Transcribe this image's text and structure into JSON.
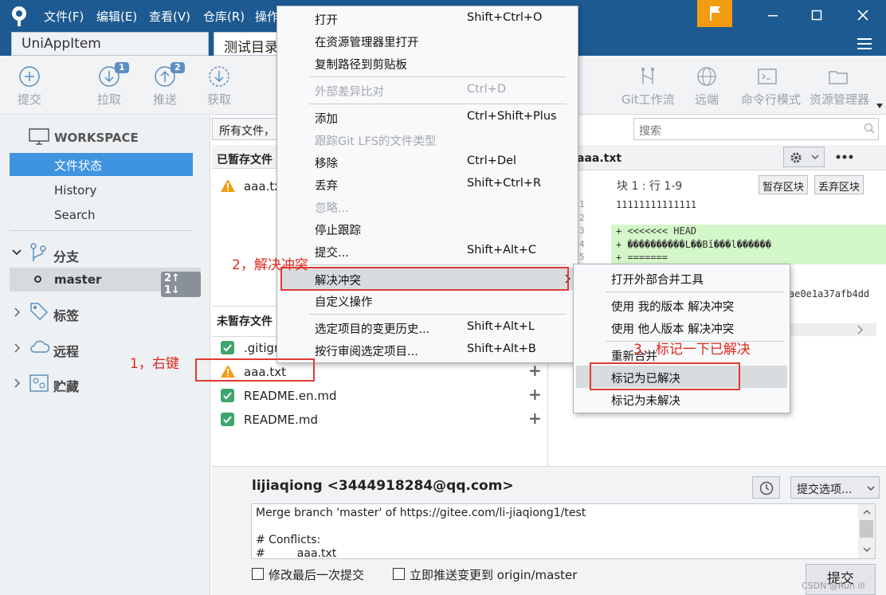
{
  "menubar": {
    "items": [
      "文件(F)",
      "编辑(E)",
      "查看(V)",
      "仓库(R)",
      "操作"
    ]
  },
  "tabs": [
    "UniAppItem",
    "测试目录"
  ],
  "toolbar": {
    "commit": "提交",
    "pull": "拉取",
    "push": "推送",
    "fetch": "获取",
    "pull_badge": "1",
    "push_badge": "2",
    "gitflow": "Git工作流",
    "remote": "远端",
    "terminal": "命令行模式",
    "explorer": "资源管理器"
  },
  "sidebar": {
    "workspace": "WORKSPACE",
    "file_status": "文件状态",
    "history": "History",
    "search": "Search",
    "branches": "分支",
    "master": "master",
    "master_badge": "2↑ 1↓",
    "tags": "标签",
    "remotes": "远程",
    "stashes": "贮藏"
  },
  "filter": {
    "label": "所有文件，",
    "search_placeholder": "搜索"
  },
  "staged": {
    "title": "已暂存文件",
    "files": [
      "aaa.txt"
    ]
  },
  "unstaged": {
    "title": "未暂存文件",
    "files": [
      ".gitignore",
      "aaa.txt",
      "README.en.md",
      "README.md"
    ]
  },
  "diff": {
    "filename": "aaa.txt",
    "hunk": "块 1 :  行 1-9",
    "stage_hunk": "暂存区块",
    "discard_hunk": "丢弃区块",
    "line_numbers": [
      "1",
      "2",
      "3",
      "4",
      "5"
    ],
    "lines": [
      "11111111111111",
      "",
      "+ <<<<<<< HEAD",
      "+ ����������L��Bǐ���l������",
      "+ ======="
    ],
    "hash_fragment": "ae0e1a37afb4dd"
  },
  "commit_area": {
    "author": "lijiaqiong <3444918284@qq.com>",
    "options": "提交选项...",
    "message_lines": [
      "Merge branch 'master' of https://gitee.com/li-jiaqiong1/test",
      "",
      "# Conflicts:",
      "#         aaa.txt"
    ],
    "amend": "修改最后一次提交",
    "push_now": "立即推送变更到 origin/master",
    "commit_button": "提交"
  },
  "context_menu": {
    "items": [
      {
        "label": "打开",
        "shortcut": "Shift+Ctrl+O",
        "enabled": true
      },
      {
        "label": "在资源管理器里打开",
        "shortcut": "",
        "enabled": true
      },
      {
        "label": "复制路径到剪贴板",
        "shortcut": "",
        "enabled": true
      },
      {
        "label": "外部差异比对",
        "shortcut": "Ctrl+D",
        "enabled": false
      },
      {
        "label": "添加",
        "shortcut": "Ctrl+Shift+Plus",
        "enabled": true
      },
      {
        "label": "跟踪Git LFS的文件类型",
        "shortcut": "",
        "enabled": false
      },
      {
        "label": "移除",
        "shortcut": "Ctrl+Del",
        "enabled": true
      },
      {
        "label": "丢弃",
        "shortcut": "Shift+Ctrl+R",
        "enabled": true
      },
      {
        "label": "忽略...",
        "shortcut": "",
        "enabled": false
      },
      {
        "label": "停止跟踪",
        "shortcut": "",
        "enabled": true
      },
      {
        "label": "提交...",
        "shortcut": "Shift+Alt+C",
        "enabled": true
      },
      {
        "label": "解决冲突",
        "shortcut": "",
        "enabled": true
      },
      {
        "label": "自定义操作",
        "shortcut": "",
        "enabled": true
      },
      {
        "label": "选定项目的变更历史...",
        "shortcut": "Shift+Alt+L",
        "enabled": true
      },
      {
        "label": "按行审阅选定项目...",
        "shortcut": "Shift+Alt+B",
        "enabled": true
      }
    ]
  },
  "submenu": {
    "items": [
      "打开外部合并工具",
      "使用 我的版本 解决冲突",
      "使用 他人版本 解决冲突",
      "重新合并",
      "标记为已解决",
      "标记为未解决"
    ]
  },
  "annotations": {
    "step1": "1，右键",
    "step2": "2，解决冲突",
    "step3": "3，标记一下已解决"
  },
  "watermark": "CSDN @Run ill"
}
